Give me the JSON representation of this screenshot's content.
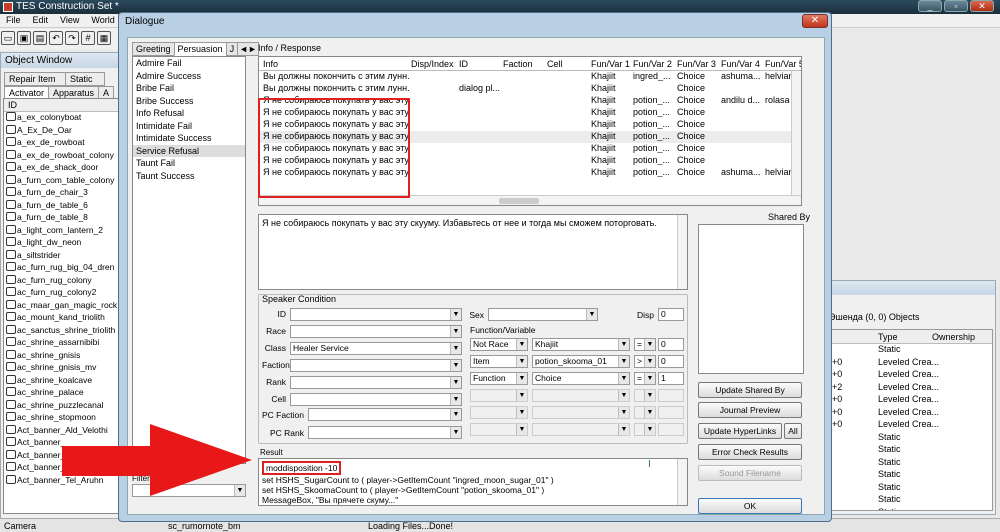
{
  "app": {
    "title": "TES Construction Set *",
    "window_buttons": [
      "_",
      "▫",
      "✕"
    ]
  },
  "menu": [
    "File",
    "Edit",
    "View",
    "World"
  ],
  "toolbar_icons": [
    "new-icon",
    "save-icon",
    "undo-icon",
    "redo-icon",
    "grid-icon",
    "snap-icon"
  ],
  "object_window": {
    "title": "Object Window",
    "tabs_row1": [
      "Repair Item",
      "Static"
    ],
    "tabs_row2": [
      "Activator",
      "Apparatus",
      "A"
    ],
    "column": "ID",
    "items": [
      "a_ex_colonyboat",
      "A_Ex_De_Oar",
      "a_ex_de_rowboat",
      "a_ex_de_rowboat_colony",
      "a_ex_de_shack_door",
      "a_furn_com_table_colony",
      "a_furn_de_chair_3",
      "a_furn_de_table_6",
      "a_furn_de_table_8",
      "a_light_com_lantern_2",
      "a_light_dw_neon",
      "a_siltstrider",
      "ac_furn_rug_big_04_dren",
      "ac_furn_rug_colony",
      "ac_furn_rug_colony2",
      "ac_maar_gan_magic_rock",
      "ac_mount_kand_triolith",
      "ac_sanctus_shrine_triolith",
      "ac_shrine_assarnibibi",
      "ac_shrine_gnisis",
      "ac_shrine_gnisis_mv",
      "ac_shrine_koalcave",
      "ac_shrine_palace",
      "ac_shrine_puzzlecanal",
      "ac_shrine_stopmoon",
      "Act_banner_Ald_Velothi",
      "Act_banner_",
      "Act_banner_",
      "Act_banner_Sadrith_Mora",
      "Act_banner_Tel_Aruhn"
    ]
  },
  "status_bar": {
    "left": "Camera",
    "middle": "sc_rumornote_bm",
    "right": "Loading Files...Done!"
  },
  "right_panel": {
    "title": "Эшенда (0, 0) Objects",
    "columns": [
      "Type",
      "Ownership"
    ],
    "rows": [
      {
        "id": "",
        "type": "Static"
      },
      {
        "id": "+0",
        "type": "Leveled Crea..."
      },
      {
        "id": "+0",
        "type": "Leveled Crea..."
      },
      {
        "id": "+2",
        "type": "Leveled Crea..."
      },
      {
        "id": "+0",
        "type": "Leveled Crea..."
      },
      {
        "id": "+0",
        "type": "Leveled Crea..."
      },
      {
        "id": "+0",
        "type": "Leveled Crea..."
      },
      {
        "id": "",
        "type": "Static"
      },
      {
        "id": "",
        "type": "Static"
      },
      {
        "id": "",
        "type": "Static"
      },
      {
        "id": "",
        "type": "Static"
      },
      {
        "id": "",
        "type": "Static"
      },
      {
        "id": "",
        "type": "Static"
      },
      {
        "id": "",
        "type": "Static"
      }
    ]
  },
  "dialog": {
    "title": "Dialogue",
    "close": "✕",
    "tabs": [
      "Greeting",
      "Persuasion",
      "J"
    ],
    "tab_arrows": "◄►",
    "topics": [
      "Admire Fail",
      "Admire Success",
      "Bribe Fail",
      "Bribe Success",
      "Info Refusal",
      "Intimidate Fail",
      "Intimidate Success",
      "Service Refusal",
      "Taunt Fail",
      "Taunt Success"
    ],
    "selected_topic": "Service Refusal",
    "info_label": "Info / Response",
    "info_columns": [
      "Info",
      "Disp/Index",
      "ID",
      "Faction",
      "Cell",
      "Fun/Var 1",
      "Fun/Var 2",
      "Fun/Var 3",
      "Fun/Var 4",
      "Fun/Var 5"
    ],
    "info_rows": [
      {
        "info": "Вы должны покончить с этим лунн...",
        "disp": "",
        "id": "",
        "faction": "",
        "cell": "",
        "f1": "Khajiit",
        "f2": "ingred_...",
        "f3": "Choice",
        "f4": "ashuma...",
        "f5": "helvian..."
      },
      {
        "info": "Вы должны покончить с этим лунн...",
        "disp": "",
        "id": "dialog pl...",
        "faction": "",
        "cell": "",
        "f1": "Khajiit",
        "f2": "",
        "f3": "Choice",
        "f4": "",
        "f5": ""
      },
      {
        "info": "Я не собираюсь покупать у вас эту ...",
        "disp": "",
        "id": "",
        "faction": "",
        "cell": "",
        "f1": "Khajiit",
        "f2": "potion_...",
        "f3": "Choice",
        "f4": "andilu d...",
        "f5": "rolasa o..."
      },
      {
        "info": "Я не собираюсь покупать у вас эту ...",
        "disp": "",
        "id": "",
        "faction": "",
        "cell": "",
        "f1": "Khajiit",
        "f2": "potion_...",
        "f3": "Choice",
        "f4": "",
        "f5": ""
      },
      {
        "info": "Я не собираюсь покупать у вас эту ...",
        "disp": "",
        "id": "",
        "faction": "",
        "cell": "",
        "f1": "Khajiit",
        "f2": "potion_...",
        "f3": "Choice",
        "f4": "",
        "f5": ""
      },
      {
        "info": "Я не собираюсь покупать у вас эту ...",
        "disp": "",
        "id": "",
        "faction": "",
        "cell": "",
        "f1": "Khajiit",
        "f2": "potion_...",
        "f3": "Choice",
        "f4": "",
        "f5": ""
      },
      {
        "info": "Я не собираюсь покупать у вас эту ...",
        "disp": "",
        "id": "",
        "faction": "",
        "cell": "",
        "f1": "Khajiit",
        "f2": "potion_...",
        "f3": "Choice",
        "f4": "",
        "f5": ""
      },
      {
        "info": "Я не собираюсь покупать у вас эту ...",
        "disp": "",
        "id": "",
        "faction": "",
        "cell": "",
        "f1": "Khajiit",
        "f2": "potion_...",
        "f3": "Choice",
        "f4": "",
        "f5": ""
      },
      {
        "info": "Я не собираюсь покупать у вас эту ...",
        "disp": "",
        "id": "",
        "faction": "",
        "cell": "",
        "f1": "Khajiit",
        "f2": "potion_...",
        "f3": "Choice",
        "f4": "ashuma...",
        "f5": "helvian..."
      }
    ],
    "response_text": "Я не собираюсь покупать у вас эту скууму. Избавьтесь от нее и тогда мы сможем поторговать.",
    "shared_by_label": "Shared By",
    "speaker_condition": {
      "label": "Speaker Condition",
      "id_label": "ID",
      "race_label": "Race",
      "class_label": "Class",
      "class_value": "Healer Service",
      "faction_label": "Faction",
      "rank_label": "Rank",
      "cell_label": "Cell",
      "pc_faction_label": "PC Faction",
      "pc_rank_label": "PC Rank",
      "sex_label": "Sex",
      "disp_label": "Disp",
      "disp_value": "0",
      "func_label": "Function/Variable",
      "funcs": [
        {
          "type": "Not Race",
          "name": "Khajiit",
          "op": "=",
          "value": "0"
        },
        {
          "type": "Item",
          "name": "potion_skooma_01",
          "op": ">",
          "value": "0"
        },
        {
          "type": "Function",
          "name": "Choice",
          "op": "=",
          "value": "1"
        }
      ]
    },
    "result_label": "Result",
    "result_lines": [
      "moddisposition -10",
      "set HSHS_SugarCount to ( player->GetItemCount \"ingred_moon_sugar_01\" )",
      "set HSHS_SkoomaCount to ( player->GetItemCount \"potion_skooma_01\" )",
      "MessageBox, \"Вы прячете скуму...\""
    ],
    "buttons": {
      "update_shared_by": "Update Shared By",
      "journal_preview": "Journal Preview",
      "update_hyperlinks": "Update HyperLinks",
      "all": "All",
      "error_check": "Error Check Results",
      "sound_filename": "Sound Filename",
      "ok": "OK"
    },
    "filter_label": "Filter for"
  },
  "colors": {
    "highlight_box": "#e02020",
    "arrow": "#e81818",
    "dialog_frame": "#b9d0e4"
  }
}
